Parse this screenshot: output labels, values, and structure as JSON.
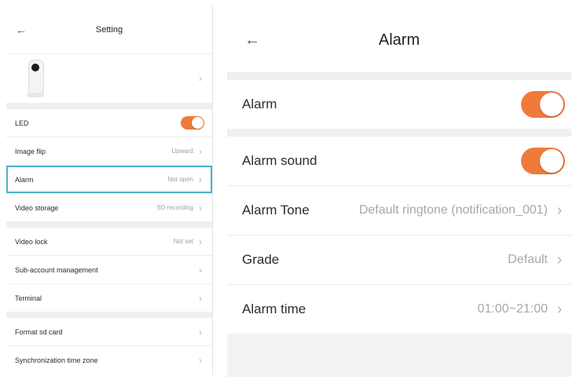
{
  "setting_screen": {
    "title": "Setting",
    "back_icon": "←",
    "chevron": "›",
    "rows": {
      "led": {
        "label": "LED",
        "toggle_on": true
      },
      "image_flip": {
        "label": "Image flip",
        "value": "Upward"
      },
      "alarm": {
        "label": "Alarm",
        "value": "Not open"
      },
      "video_storage": {
        "label": "Video storage",
        "value": "SD recording"
      },
      "video_lock": {
        "label": "Video lock",
        "value": "Not set"
      },
      "sub_account": {
        "label": "Sub-account management"
      },
      "terminal": {
        "label": "Terminal"
      },
      "format_sd": {
        "label": "Format sd card"
      },
      "sync_tz": {
        "label": "Synchronization time zone"
      }
    }
  },
  "alarm_screen": {
    "title": "Alarm",
    "back_icon": "←",
    "chevron": "›",
    "rows": {
      "alarm": {
        "label": "Alarm",
        "toggle_on": true
      },
      "alarm_sound": {
        "label": "Alarm sound",
        "toggle_on": true
      },
      "alarm_tone": {
        "label": "Alarm Tone",
        "value": "Default ringtone (notification_001)"
      },
      "grade": {
        "label": "Grade",
        "value": "Default"
      },
      "alarm_time": {
        "label": "Alarm time",
        "value": "01:00~21:00"
      }
    }
  },
  "colors": {
    "accent": "#f07a3a",
    "highlight": "#4fb3c9",
    "section_gap": "#efefef"
  }
}
